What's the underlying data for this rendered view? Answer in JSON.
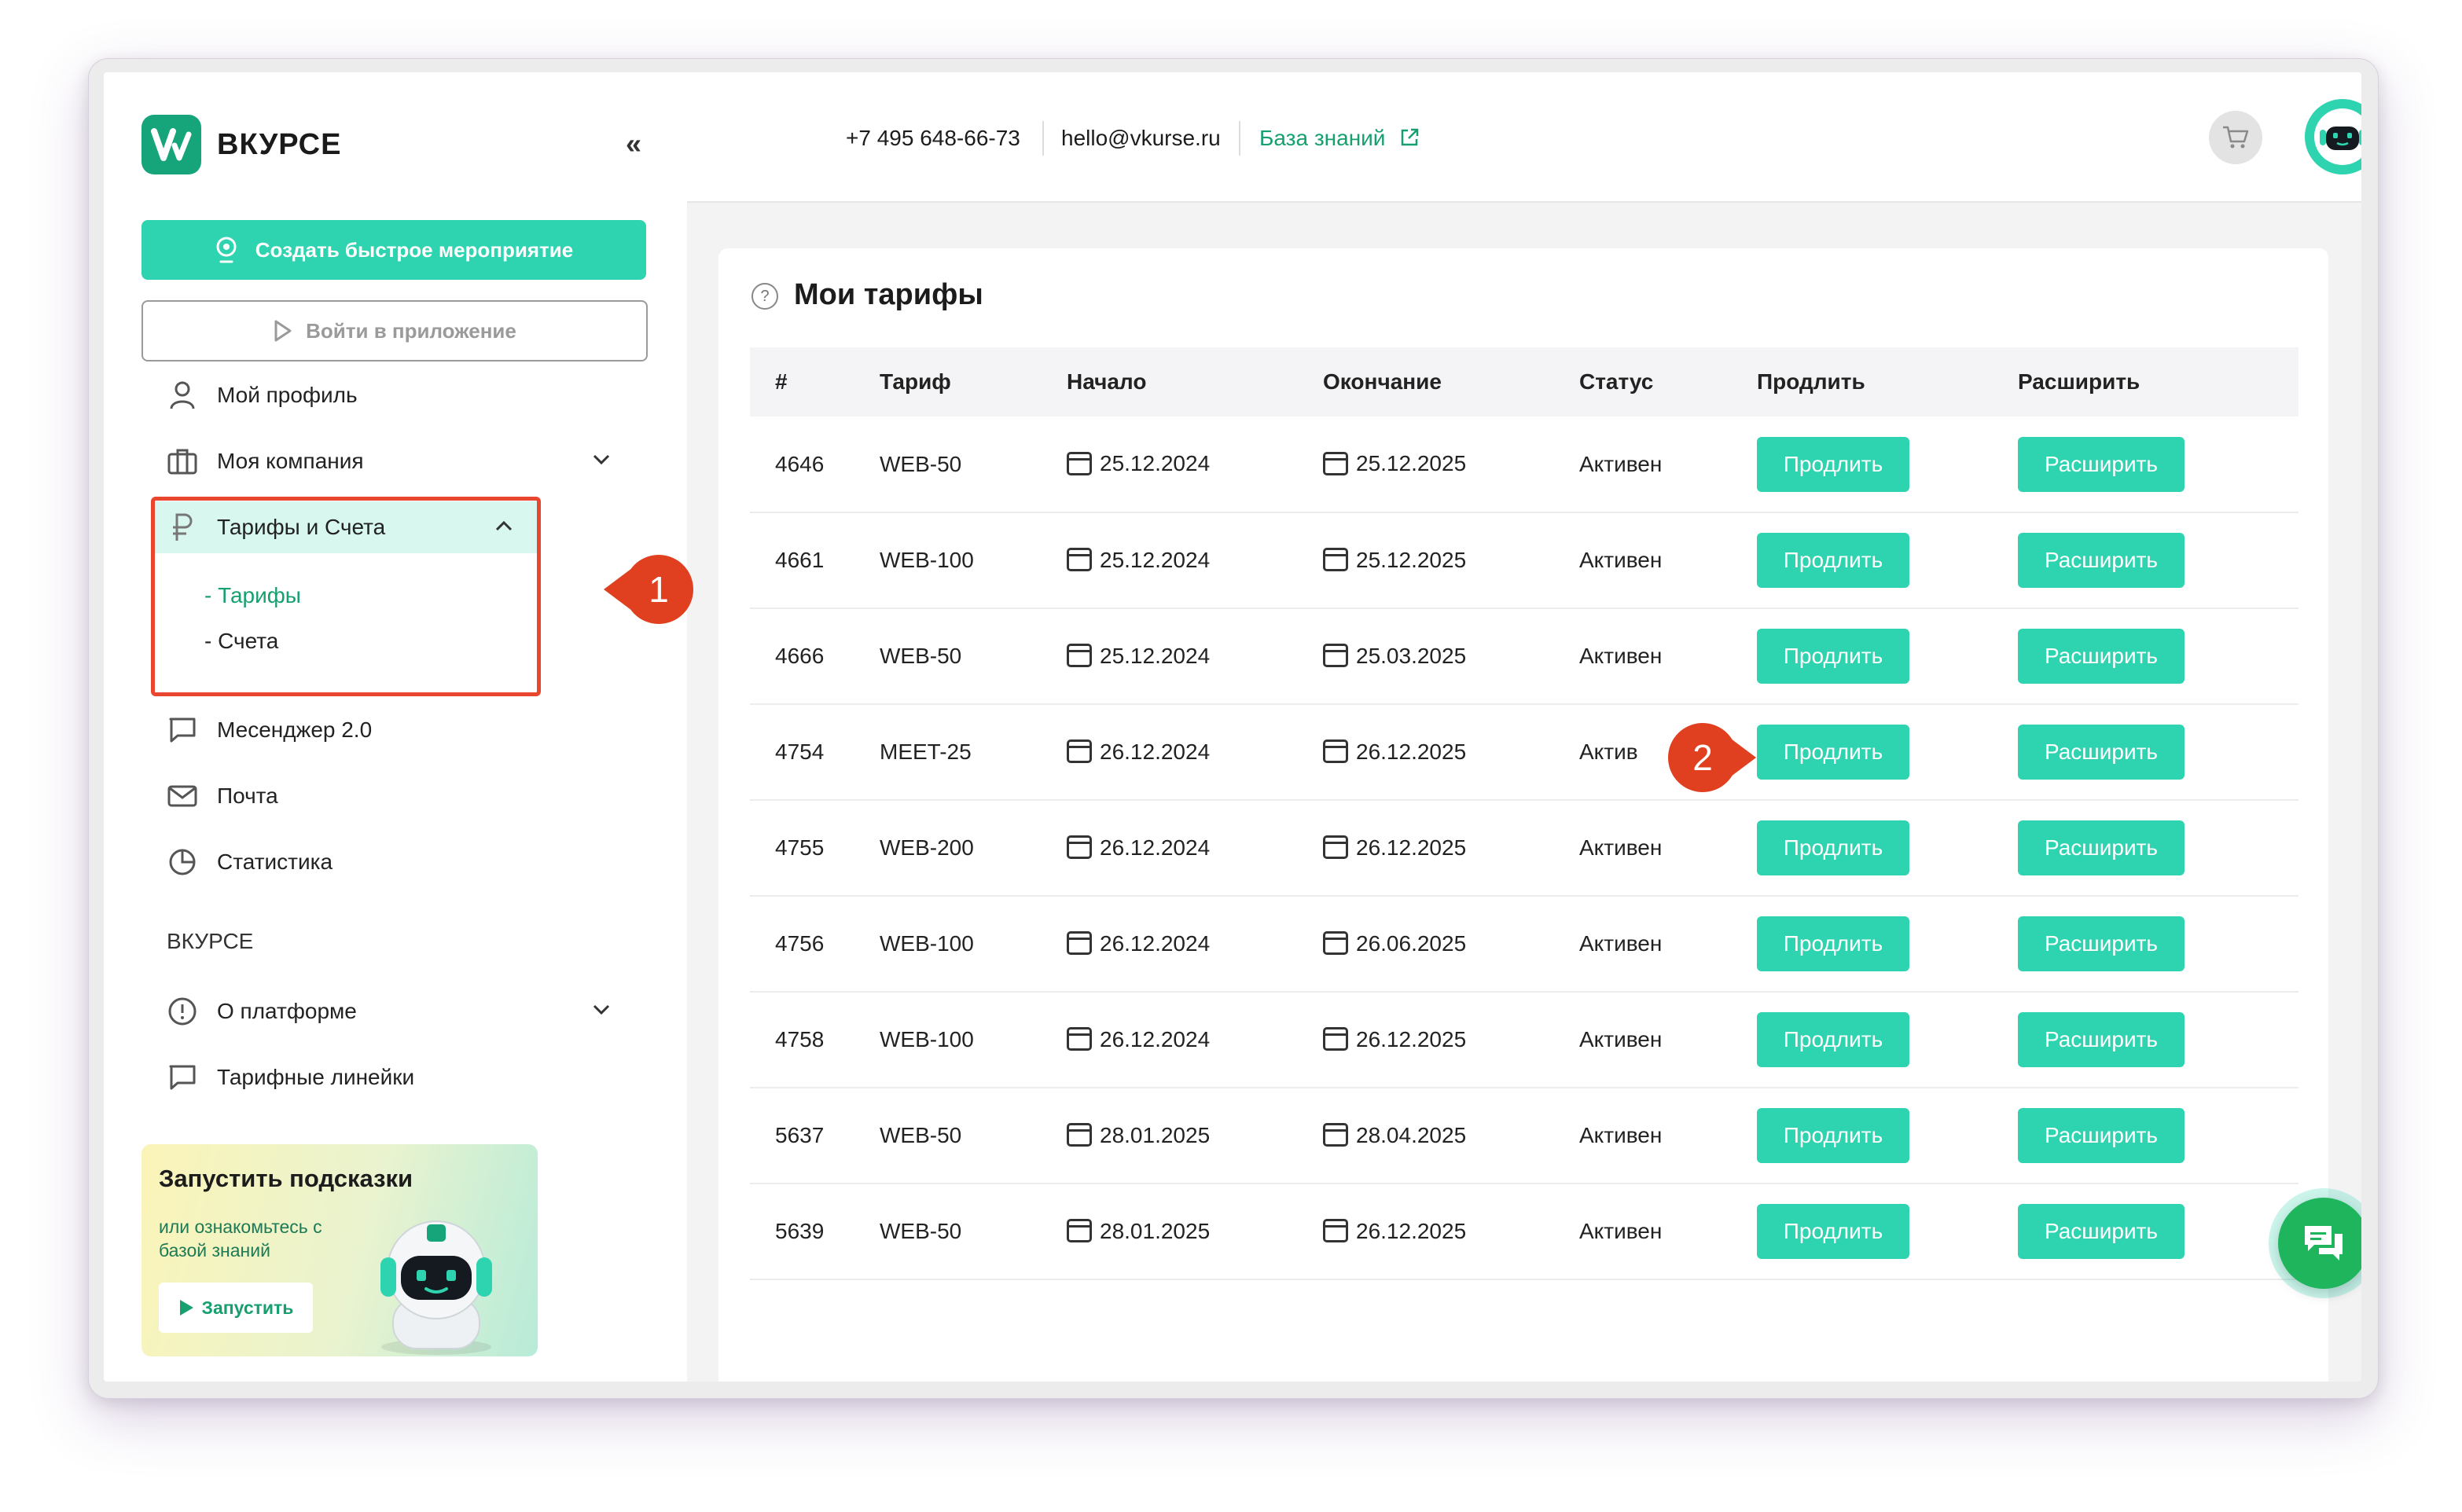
{
  "brand": {
    "name": "ВКУРСЕ",
    "accent": "#2ed3b0",
    "brand_green": "#16a47a",
    "callout_color": "#e0401f"
  },
  "sidebar": {
    "create_button": "Создать быстрое мероприятие",
    "app_button": "Войти в приложение",
    "items": [
      {
        "label": "Мой профиль",
        "icon": "user-icon"
      },
      {
        "label": "Моя компания",
        "icon": "briefcase-icon"
      },
      {
        "label": "Тарифы и Счета",
        "icon": "ruble-icon"
      },
      {
        "label": "Месенджер 2.0",
        "icon": "chat-bubble-icon"
      },
      {
        "label": "Почта",
        "icon": "mail-icon"
      },
      {
        "label": "Статистика",
        "icon": "pie-chart-icon"
      }
    ],
    "subitems": [
      "- Тарифы",
      "- Счета"
    ],
    "section_label": "ВКУРСЕ",
    "section_items": [
      {
        "label": "О платформе",
        "icon": "info-icon"
      },
      {
        "label": "Тарифные линейки",
        "icon": "chat-bubble-icon"
      }
    ],
    "promo": {
      "title": "Запустить подсказки",
      "subtitle": "или ознакомьтесь с базой знаний",
      "button": "Запустить"
    }
  },
  "header": {
    "phone": "+7 495 648-66-73",
    "email": "hello@vkurse.ru",
    "knowledge_base": "База знаний"
  },
  "callouts": [
    "1",
    "2"
  ],
  "tariffs": {
    "title": "Мои тарифы",
    "columns": [
      "#",
      "Тариф",
      "Начало",
      "Окончание",
      "Статус",
      "Продлить",
      "Расширить"
    ],
    "extend_label": "Продлить",
    "expand_label": "Расширить",
    "rows": [
      {
        "id": "4646",
        "plan": "WEB-50",
        "start": "25.12.2024",
        "end": "25.12.2025",
        "status": "Активен"
      },
      {
        "id": "4661",
        "plan": "WEB-100",
        "start": "25.12.2024",
        "end": "25.12.2025",
        "status": "Активен"
      },
      {
        "id": "4666",
        "plan": "WEB-50",
        "start": "25.12.2024",
        "end": "25.03.2025",
        "status": "Активен"
      },
      {
        "id": "4754",
        "plan": "MEET-25",
        "start": "26.12.2024",
        "end": "26.12.2025",
        "status": "Актив"
      },
      {
        "id": "4755",
        "plan": "WEB-200",
        "start": "26.12.2024",
        "end": "26.12.2025",
        "status": "Активен"
      },
      {
        "id": "4756",
        "plan": "WEB-100",
        "start": "26.12.2024",
        "end": "26.06.2025",
        "status": "Активен"
      },
      {
        "id": "4758",
        "plan": "WEB-100",
        "start": "26.12.2024",
        "end": "26.12.2025",
        "status": "Активен"
      },
      {
        "id": "5637",
        "plan": "WEB-50",
        "start": "28.01.2025",
        "end": "28.04.2025",
        "status": "Активен"
      },
      {
        "id": "5639",
        "plan": "WEB-50",
        "start": "28.01.2025",
        "end": "26.12.2025",
        "status": "Активен"
      }
    ]
  }
}
